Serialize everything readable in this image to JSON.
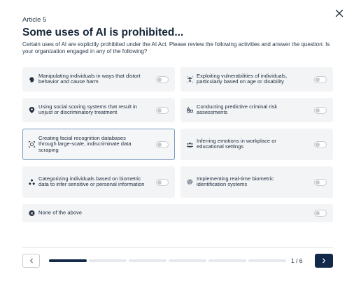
{
  "header": {
    "eyebrow": "Article 5",
    "title": "Some uses of AI is prohibited...",
    "description": "Certain uses of AI are explicitly prohibited under the AI Act. Please review the following activities and answer the question: Is your organization engaged in any of the following?"
  },
  "options": [
    {
      "label": "Manipulating individuals in ways that distort behavior and cause harm",
      "icon": "brain-icon",
      "enabled": false
    },
    {
      "label": "Exploiting vulnerabilities of individuals, particularly based on age or disability",
      "icon": "accessibility-icon",
      "enabled": false
    },
    {
      "label": "Using social scoring systems that result in unjust or discriminatory treatment",
      "icon": "location-pin-icon",
      "enabled": false
    },
    {
      "label": "Conducting predictive criminal risk assessments",
      "icon": "shapes-icon",
      "enabled": false
    },
    {
      "label": "Creating facial recognition databases through large-scale, indiscriminate data scraping",
      "icon": "face-scan-icon",
      "enabled": false,
      "selected": true
    },
    {
      "label": "Inferring emotions in workplace or educational settings",
      "icon": "group-icon",
      "enabled": false
    },
    {
      "label": "Categorizing individuals based on biometric data to infer sensitive or personal information",
      "icon": "nodes-icon",
      "enabled": false
    },
    {
      "label": "Implementing real-time biometric identification systems",
      "icon": "fingerprint-icon",
      "enabled": false
    },
    {
      "label": "None of the above",
      "icon": "close-circle-icon",
      "enabled": false
    }
  ],
  "footer": {
    "page_count": "1 / 6",
    "progress": {
      "current": 1,
      "total": 6
    }
  },
  "colors": {
    "accent": "#12294a",
    "card_bg": "#f3f4f6",
    "selected_border": "#7d9cc0"
  }
}
